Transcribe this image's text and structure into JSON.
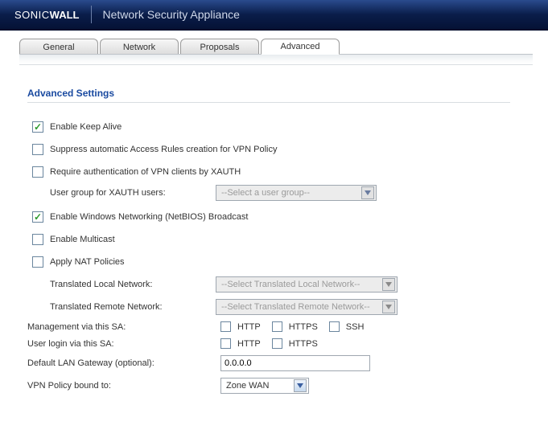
{
  "header": {
    "brand_html": "SONIC",
    "brand_bold": "WALL",
    "app_name": "Network Security Appliance"
  },
  "tabs": {
    "general": "General",
    "network": "Network",
    "proposals": "Proposals",
    "advanced": "Advanced"
  },
  "section_title": "Advanced Settings",
  "options": {
    "keep_alive": "Enable Keep Alive",
    "suppress_rules": "Suppress automatic Access Rules creation for VPN Policy",
    "require_xauth": "Require authentication of VPN clients by XAUTH",
    "xauth_group_label": "User group for XAUTH users:",
    "xauth_group_select": "--Select a user group--",
    "netbios": "Enable Windows Networking (NetBIOS) Broadcast",
    "multicast": "Enable Multicast",
    "apply_nat": "Apply NAT Policies",
    "trans_local_label": "Translated Local Network:",
    "trans_local_select": "--Select Translated Local Network--",
    "trans_remote_label": "Translated Remote Network:",
    "trans_remote_select": "--Select Translated Remote Network--",
    "mgmt_label": "Management via this SA:",
    "login_label": "User login via this SA:",
    "http": "HTTP",
    "https": "HTTPS",
    "ssh": "SSH",
    "gateway_label": "Default LAN Gateway (optional):",
    "gateway_value": "0.0.0.0",
    "bound_label": "VPN Policy bound to:",
    "bound_value": "Zone WAN"
  }
}
